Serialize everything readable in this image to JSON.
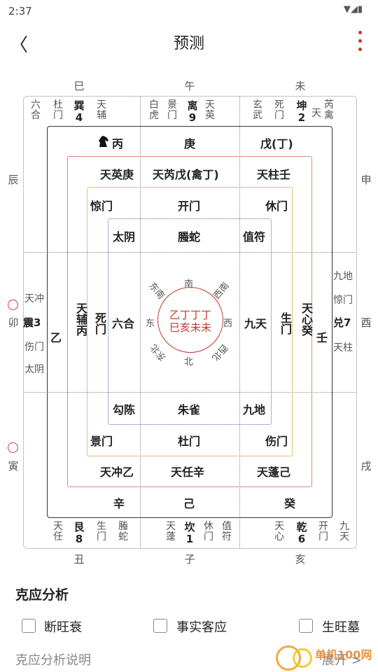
{
  "status": {
    "time": "2:37",
    "icons": "▼◢▮"
  },
  "appbar": {
    "title": "预测",
    "back": "〈"
  },
  "branches": {
    "top": [
      "巳",
      "午",
      "未"
    ],
    "bottom": [
      "丑",
      "子",
      "亥"
    ],
    "left": [
      "辰",
      "卯",
      "寅"
    ],
    "right": [
      "申",
      "酉",
      "戌"
    ]
  },
  "outer": {
    "nw": {
      "a": "六合",
      "b": "杜门",
      "c": "巽4",
      "d": "天辅"
    },
    "n": {
      "a": "白虎",
      "b": "景门",
      "c": "离9",
      "d": "天英"
    },
    "ne": {
      "a": "玄武",
      "b": "死门",
      "c": "坤2",
      "d": "天",
      "e": "芮禽"
    },
    "w": {
      "a": "天冲",
      "c": "震3",
      "b": "伤门",
      "d": "太阴"
    },
    "e": {
      "a": "九地",
      "b": "惊门",
      "c": "兑7",
      "d": "天柱"
    },
    "sw": {
      "a": "天任",
      "c": "艮8",
      "b": "生门",
      "d": "螣蛇"
    },
    "s": {
      "a": "天蓬",
      "c": "坎1",
      "b": "休门",
      "d": "值符"
    },
    "se": {
      "a": "天心",
      "c": "乾6",
      "b": "开门",
      "d": "九天"
    }
  },
  "earth": {
    "nw": "丙",
    "n": "庚",
    "ne": "戊(丁)",
    "w": "乙",
    "e": "壬",
    "sw": "辛",
    "s": "己",
    "se": "癸"
  },
  "stars": {
    "nw": "天英庚",
    "n": "天芮戊(禽丁)",
    "ne": "天柱壬",
    "w": "天辅丙",
    "e": "天心癸",
    "sw": "天冲乙",
    "s": "天任辛",
    "se": "天蓬己"
  },
  "doors": {
    "nw": "惊门",
    "n": "开门",
    "ne": "休门",
    "w": "死门",
    "e": "生门",
    "sw": "景门",
    "s": "杜门",
    "se": "伤门"
  },
  "gods": {
    "nw": "太阴",
    "n": "螣蛇",
    "ne": "值符",
    "w": "六合",
    "e": "九天",
    "sw": "勾陈",
    "s": "朱雀",
    "se": "九地"
  },
  "compass": {
    "n": "南",
    "s": "北",
    "e": "西",
    "w": "东",
    "ne": "西南",
    "nw": "东南",
    "se": "西北",
    "sw": "东北",
    "line1": "乙丁丁丁",
    "line2": "巳亥未未"
  },
  "analysis": {
    "title": "克应分析",
    "options": [
      "断旺衰",
      "事实客应",
      "生旺墓"
    ],
    "explain": "克应分析说明",
    "expand": "展开 >"
  },
  "watermark": "单机100网"
}
